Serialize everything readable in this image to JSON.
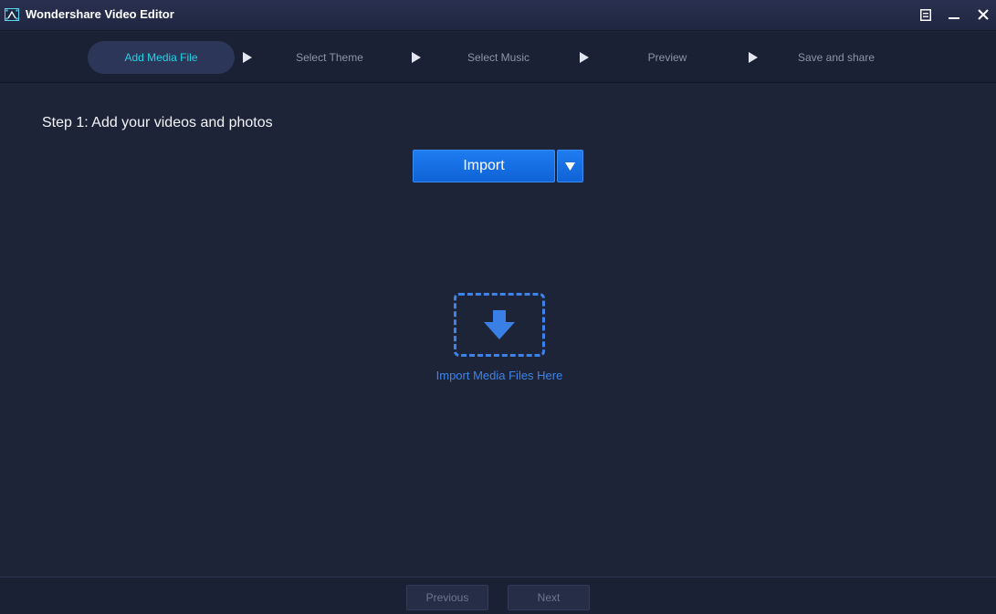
{
  "app": {
    "title": "Wondershare Video Editor"
  },
  "steps": [
    {
      "label": "Add Media File",
      "active": true
    },
    {
      "label": "Select Theme",
      "active": false
    },
    {
      "label": "Select Music",
      "active": false
    },
    {
      "label": "Preview",
      "active": false
    },
    {
      "label": "Save and share",
      "active": false
    }
  ],
  "main": {
    "heading": "Step 1: Add your videos and photos",
    "import_label": "Import",
    "dropzone_label": "Import Media Files Here"
  },
  "footer": {
    "previous_label": "Previous",
    "next_label": "Next"
  },
  "colors": {
    "background": "#1e2438",
    "accent": "#1e7cf0",
    "active_step_text": "#22d3e6",
    "dropzone": "#3f82e8"
  }
}
